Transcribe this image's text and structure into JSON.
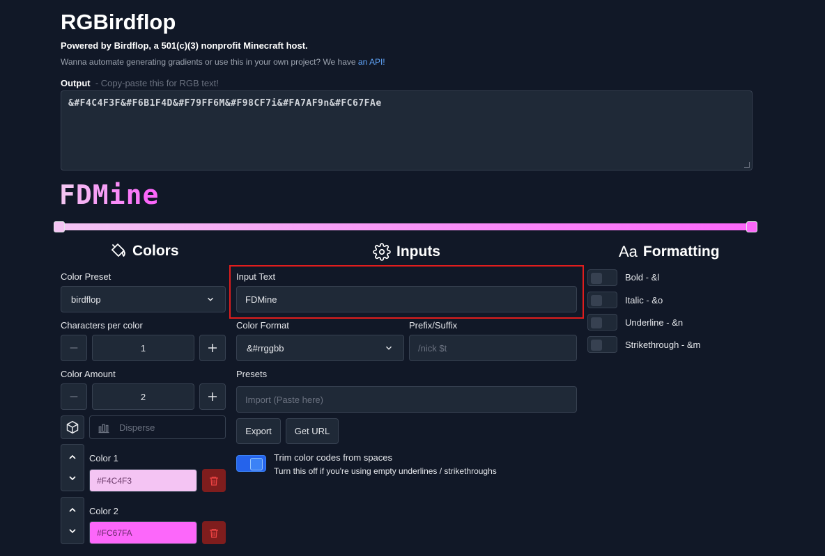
{
  "header": {
    "title": "RGBirdflop",
    "powered_by": "Powered by Birdflop, a 501(c)(3) nonprofit Minecraft host.",
    "automate_text": "Wanna automate generating gradients or use this in your own project? We have ",
    "api_link": "an API!"
  },
  "output": {
    "label": "Output",
    "hint": "- Copy-paste this for RGB text!",
    "value": "&#F4C4F3F&#F6B1F4D&#F79FF6M&#F98CF7i&#FA7AF9n&#FC67FAe"
  },
  "preview": {
    "chars": [
      {
        "c": "F",
        "color": "#F4C4F3"
      },
      {
        "c": "D",
        "color": "#F6B1F4"
      },
      {
        "c": "M",
        "color": "#F79FF6"
      },
      {
        "c": "i",
        "color": "#F98CF7"
      },
      {
        "c": "n",
        "color": "#FA7AF9"
      },
      {
        "c": "e",
        "color": "#FC67FA"
      }
    ]
  },
  "gradient": {
    "start": "#F4C4F3",
    "end": "#FC67FA"
  },
  "colors": {
    "heading": "Colors",
    "preset_label": "Color Preset",
    "preset_value": "birdflop",
    "chars_per_color_label": "Characters per color",
    "chars_per_color": "1",
    "amount_label": "Color Amount",
    "amount": "2",
    "disperse_placeholder": "Disperse",
    "items": [
      {
        "label": "Color 1",
        "value": "#F4C4F3",
        "bg": "#F4C4F3"
      },
      {
        "label": "Color 2",
        "value": "#FC67FA",
        "bg": "#FC67FA"
      }
    ]
  },
  "inputs": {
    "heading": "Inputs",
    "input_text_label": "Input Text",
    "input_text_value": "FDMine",
    "format_label": "Color Format",
    "format_value": "&#rrggbb",
    "prefix_label": "Prefix/Suffix",
    "prefix_placeholder": "/nick $t",
    "presets_label": "Presets",
    "import_placeholder": "Import (Paste here)",
    "export_label": "Export",
    "get_url_label": "Get URL",
    "trim_title": "Trim color codes from spaces",
    "trim_desc": "Turn this off if you're using empty underlines / strikethroughs"
  },
  "formatting": {
    "heading": "Formatting",
    "options": [
      {
        "label": "Bold - &l"
      },
      {
        "label": "Italic - &o"
      },
      {
        "label": "Underline - &n"
      },
      {
        "label": "Strikethrough - &m"
      }
    ]
  }
}
